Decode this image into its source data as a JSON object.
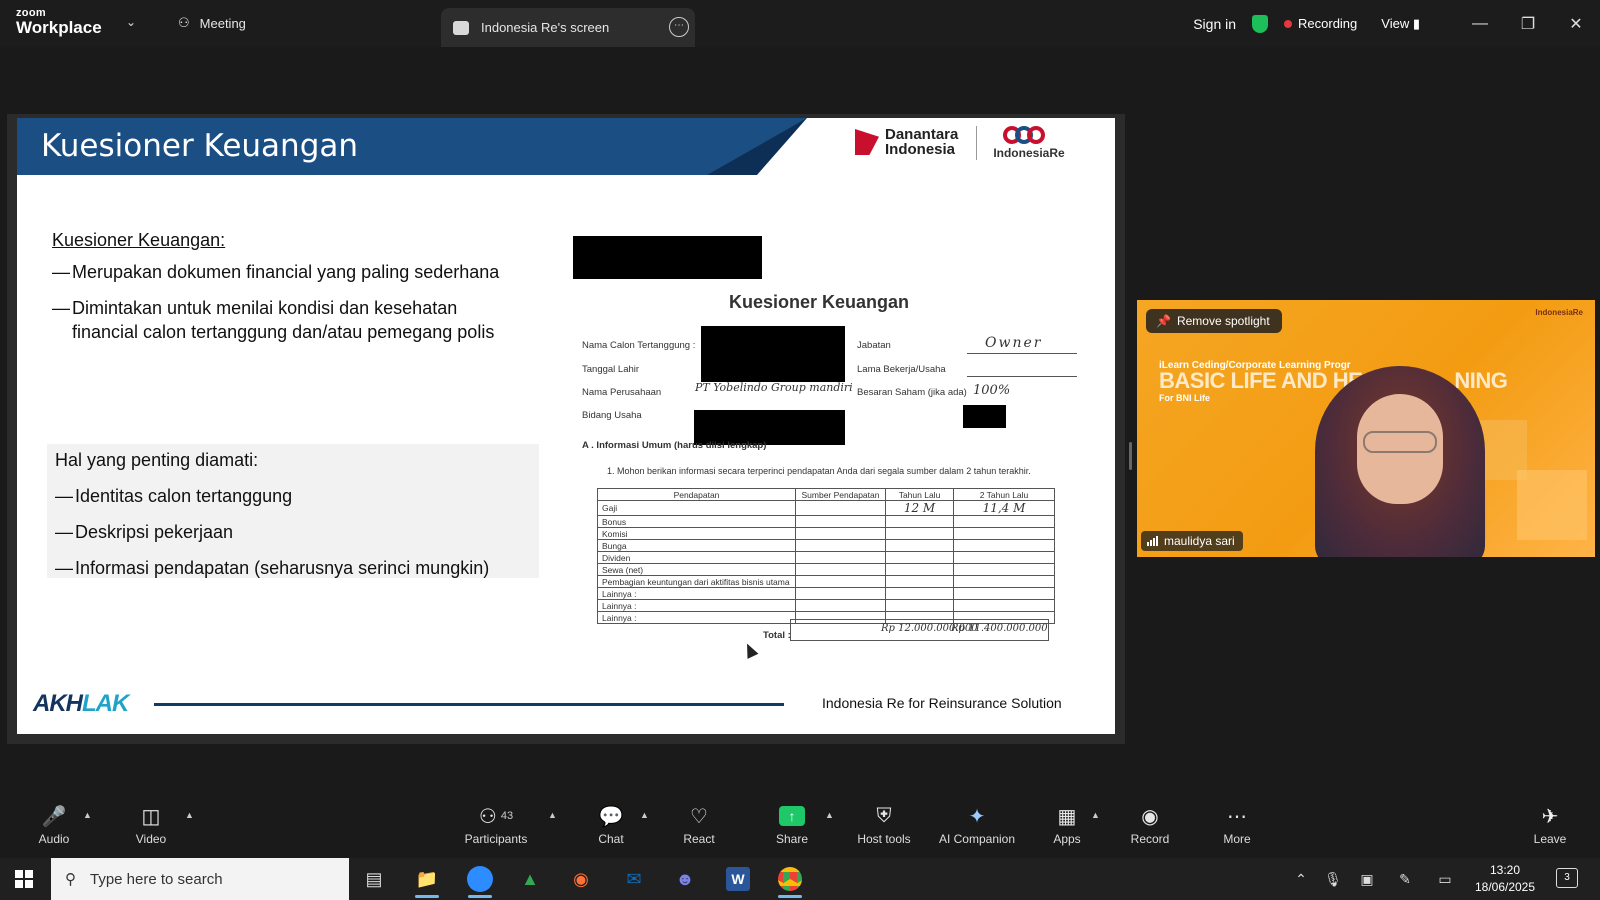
{
  "app": {
    "brand_top": "zoom",
    "brand_bottom": "Workplace",
    "meeting_tab": "Meeting",
    "screen_tab": "Indonesia Re's screen",
    "sign_in": "Sign in",
    "recording": "Recording",
    "view": "View",
    "accent_green": "#1dbf5a",
    "recording_red": "#e8383d"
  },
  "slide": {
    "title": "Kuesioner Keuangan",
    "logo_left_1": "Danantara",
    "logo_left_2": "Indonesia",
    "logo_right": "IndonesiaRe",
    "section_title": "Kuesioner Keuangan:",
    "bullets": [
      "Merupakan dokumen financial yang paling sederhana",
      "Dimintakan untuk menilai kondisi dan kesehatan",
      "financial calon tertanggung dan/atau pemegang polis"
    ],
    "important_title": "Hal yang penting diamati:",
    "important_items": [
      "Identitas calon tertanggung",
      "Deskripsi pekerjaan",
      "Informasi pendapatan (seharusnya serinci mungkin)"
    ],
    "footer_brand_1": "AKH",
    "footer_brand_2": "LAK",
    "footer_text": "Indonesia Re for Reinsurance Solution",
    "header_blue": "#1b4f84"
  },
  "form": {
    "title": "Kuesioner Keuangan",
    "labels": {
      "nama_calon": "Nama Calon Tertanggung :",
      "tanggal_lahir": "Tanggal Lahir",
      "nama_perusahaan": "Nama Perusahaan",
      "bidang_usaha": "Bidang Usaha",
      "jabatan": "Jabatan",
      "lama_bekerja": "Lama Bekerja/Usaha",
      "besaran_saham": "Besaran Saham (jika ada)"
    },
    "values": {
      "jabatan": "Owner",
      "perusahaan": "PT Yobelindo Group mandiri",
      "saham": "100%"
    },
    "section_a": "A . Informasi Umum (harus diisi lengkap)",
    "question_1": "1. Mohon berikan informasi secara terperinci pendapatan Anda dari segala sumber dalam 2 tahun terakhir.",
    "table": {
      "headers": [
        "Pendapatan",
        "Sumber Pendapatan",
        "Tahun Lalu",
        "2 Tahun Lalu"
      ],
      "rows": [
        [
          "Gaji",
          "",
          "12 M",
          "11,4 M"
        ],
        [
          "Bonus",
          "",
          "",
          ""
        ],
        [
          "Komisi",
          "",
          "",
          ""
        ],
        [
          "Bunga",
          "",
          "",
          ""
        ],
        [
          "Dividen",
          "",
          "",
          ""
        ],
        [
          "Sewa (net)",
          "",
          "",
          ""
        ],
        [
          "Pembagian keuntungan dari aktifitas bisnis utama",
          "",
          "",
          ""
        ],
        [
          "Lainnya :",
          "",
          "",
          ""
        ],
        [
          "Lainnya :",
          "",
          "",
          ""
        ],
        [
          "Lainnya :",
          "",
          "",
          ""
        ]
      ],
      "total_label": "Total :",
      "total_1": "Rp 12.000.000.000",
      "total_2": "Rp 11.400.000.000"
    }
  },
  "video": {
    "spotlight_button": "Remove spotlight",
    "background_subtitle": "iLearn Ceding/Corporate Learning Progr",
    "background_title": "BASIC LIFE AND HE",
    "background_title_end": "NING",
    "background_for": "For BNI Life",
    "participant_name": "maulidya sari"
  },
  "toolbar": {
    "audio": "Audio",
    "video": "Video",
    "participants": "Participants",
    "participants_count": "43",
    "chat": "Chat",
    "react": "React",
    "share": "Share",
    "host_tools": "Host tools",
    "ai_companion": "AI Companion",
    "apps": "Apps",
    "record": "Record",
    "more": "More",
    "leave": "Leave"
  },
  "taskbar": {
    "search_placeholder": "Type here to search",
    "time": "13:20",
    "date": "18/06/2025",
    "notification_count": "3"
  }
}
